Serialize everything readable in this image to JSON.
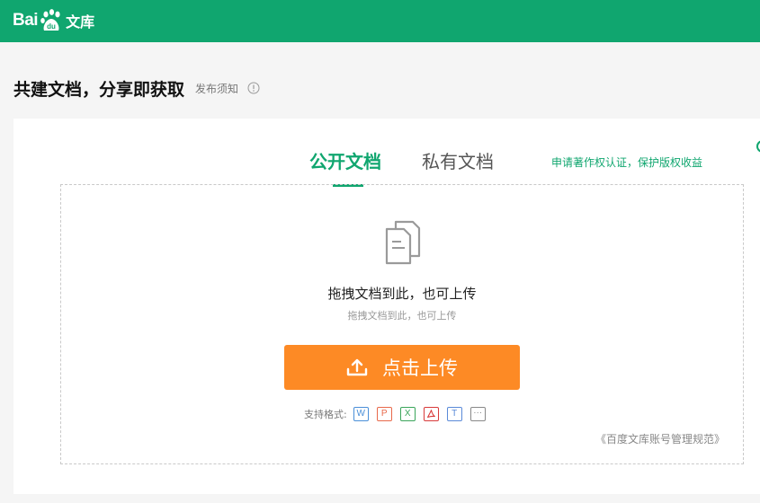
{
  "header": {
    "logo_bai": "Bai",
    "logo_du": "du",
    "logo_wenku": "文库",
    "brand_color": "#10a66f"
  },
  "heading": {
    "title": "共建文档，分享即获取",
    "notice_link": "发布须知",
    "info_icon": "info-circle-icon"
  },
  "tabs": [
    {
      "label": "公开文档",
      "active": true
    },
    {
      "label": "私有文档",
      "active": false
    }
  ],
  "copyright_link": "申请著作权认证，保护版权收益",
  "dropzone": {
    "icon": "document-stack-icon",
    "title": "拖拽文档到此，也可上传",
    "subtitle": "拖拽文档到此，也可上传"
  },
  "upload_button": {
    "label": "点击上传",
    "icon": "upload-icon",
    "color": "#fd8a25"
  },
  "formats": {
    "label": "支持格式:",
    "items": [
      {
        "glyph": "W",
        "name": "word",
        "color": "#4a8fd8"
      },
      {
        "glyph": "P",
        "name": "ppt",
        "color": "#e8694a"
      },
      {
        "glyph": "X",
        "name": "excel",
        "color": "#3aa55a"
      },
      {
        "glyph": "A",
        "name": "pdf",
        "color": "#d83a3a"
      },
      {
        "glyph": "T",
        "name": "txt",
        "color": "#5a8ad8"
      },
      {
        "glyph": "···",
        "name": "more",
        "color": "#888888"
      }
    ]
  },
  "rules_link": "《百度文库账号管理规范》"
}
